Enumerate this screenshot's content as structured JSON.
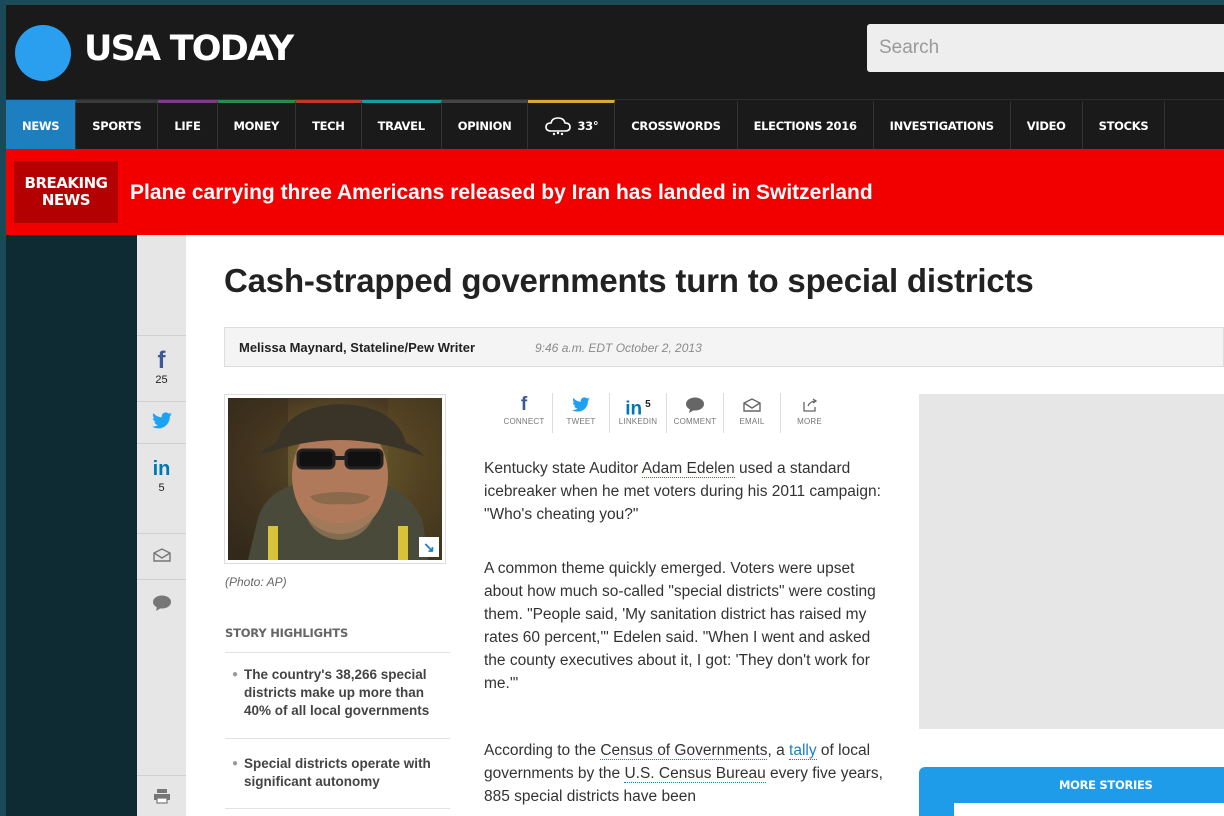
{
  "header": {
    "logo": "USA TODAY",
    "search_placeholder": "Search"
  },
  "nav": {
    "items": [
      "NEWS",
      "SPORTS",
      "LIFE",
      "MONEY",
      "TECH",
      "TRAVEL",
      "OPINION"
    ],
    "weather": "33°",
    "items_after": [
      "CROSSWORDS",
      "ELECTIONS 2016",
      "INVESTIGATIONS",
      "VIDEO",
      "STOCKS"
    ]
  },
  "breaking": {
    "label_line1": "BREAKING",
    "label_line2": "NEWS",
    "headline": "Plane carrying three Americans released by Iran has landed in Switzerland"
  },
  "social_rail": {
    "facebook_count": "25",
    "linkedin_count": "5"
  },
  "article": {
    "headline": "Cash-strapped governments turn to special districts",
    "author": "Melissa Maynard, Stateline/Pew Writer",
    "timestamp": "9:46 a.m. EDT October 2, 2013",
    "photo_credit": "(Photo: AP)",
    "highlights_title": "STORY HIGHLIGHTS",
    "highlights": [
      "The country's 38,266 special districts make up more than 40% of all local governments",
      "Special districts operate with significant autonomy"
    ],
    "share": {
      "connect": "CONNECT",
      "tweet": "TWEET",
      "linkedin": "LINKEDIN",
      "linkedin_count": "5",
      "comment": "COMMENT",
      "email": "EMAIL",
      "more": "MORE"
    },
    "p1_a": "Kentucky state Auditor ",
    "p1_link": "Adam Edelen",
    "p1_b": " used a standard icebreaker when he met voters during his 2011 campaign: \"Who's cheating you?\"",
    "p2": "A common theme quickly emerged. Voters were upset about how much so-called \"special districts\" were costing them. \"People said, 'My sanitation district has raised my rates 60 percent,'\" Edelen said. \"When I went and asked the county executives about it, I got: 'They don't work for me.'\"",
    "p3_a": "According to the ",
    "p3_link1": "Census of Governments",
    "p3_b": ", a ",
    "p3_link2": "tally",
    "p3_c": " of local governments by the ",
    "p3_link3": "U.S. Census Bureau",
    "p3_d": " every five years, 885 special districts have been"
  },
  "sidebar": {
    "more_stories": "MORE STORIES"
  }
}
